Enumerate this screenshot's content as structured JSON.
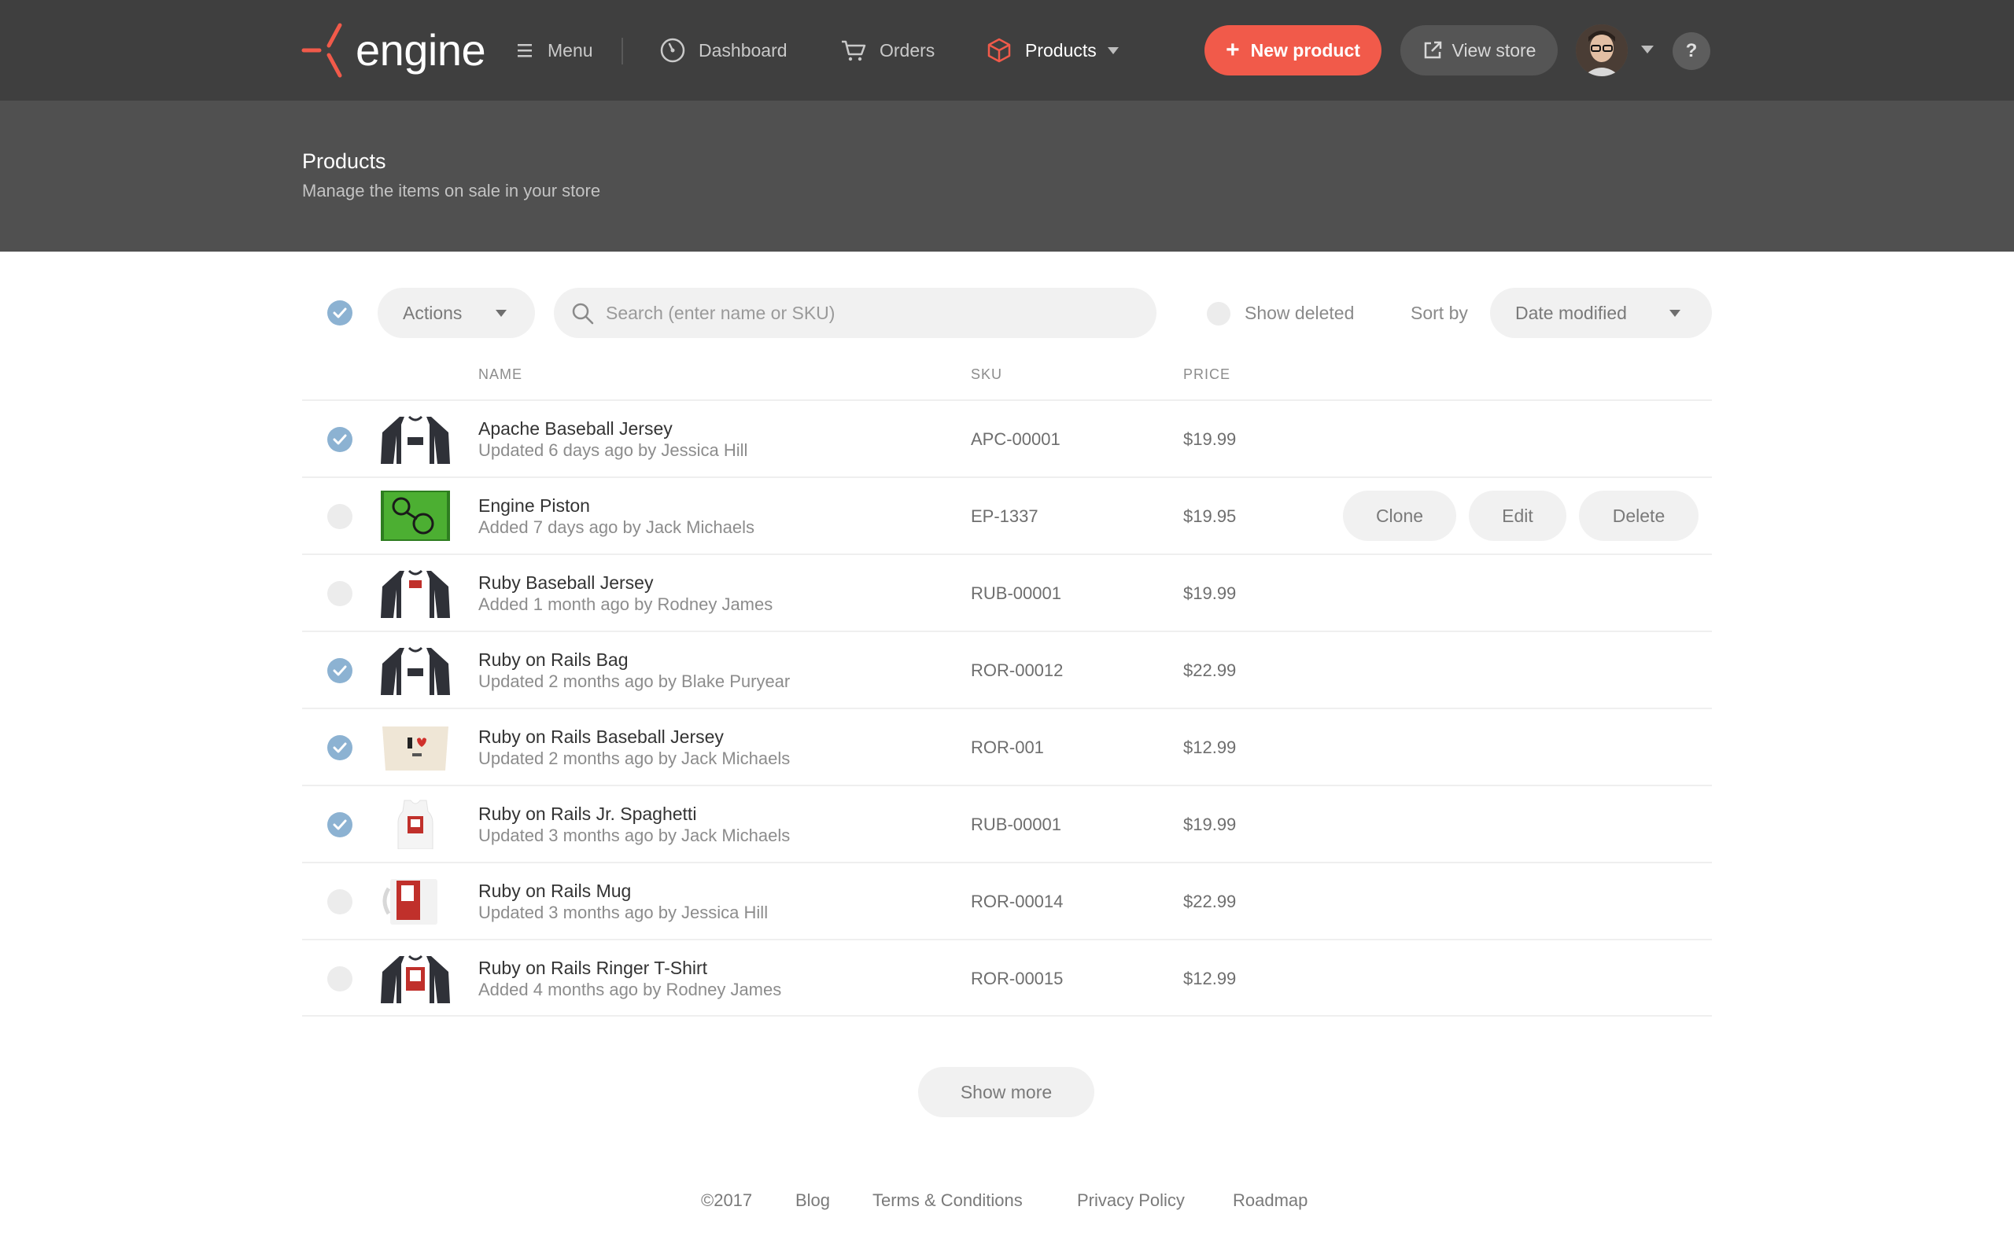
{
  "brand": {
    "name": "engine",
    "accent": "#f15a4a"
  },
  "nav": {
    "menu": "Menu",
    "dashboard": "Dashboard",
    "orders": "Orders",
    "products": "Products"
  },
  "header_actions": {
    "new_product": "New product",
    "view_store": "View store",
    "help": "?"
  },
  "page": {
    "title": "Products",
    "subtitle": "Manage the items on sale in your store"
  },
  "toolbar": {
    "select_all_checked": true,
    "actions_label": "Actions",
    "search_placeholder": "Search (enter name or SKU)",
    "search_value": "",
    "show_deleted_label": "Show deleted",
    "sort_by_label": "Sort by",
    "sort_value": "Date modified"
  },
  "table": {
    "columns": [
      "NAME",
      "SKU",
      "PRICE"
    ],
    "rows": [
      {
        "name": "Apache Baseball Jersey",
        "meta": "Updated 6 days ago by Jessica Hill",
        "sku": "APC-00001",
        "price": "$19.99",
        "checked": true,
        "thumb": "raglan-shirt-icon"
      },
      {
        "name": "Engine Piston",
        "meta": "Added 7 days ago by Jack Michaels",
        "sku": "EP-1337",
        "price": "$19.95",
        "checked": false,
        "thumb": "piston-icon"
      },
      {
        "name": "Ruby Baseball Jersey",
        "meta": "Added 1 month ago by Rodney James",
        "sku": "RUB-00001",
        "price": "$19.99",
        "checked": false,
        "thumb": "raglan-shirt-icon"
      },
      {
        "name": "Ruby on Rails Bag",
        "meta": "Updated 2 months ago by Blake Puryear",
        "sku": "ROR-00012",
        "price": "$22.99",
        "checked": true,
        "thumb": "raglan-shirt-icon"
      },
      {
        "name": "Ruby on Rails Baseball Jersey",
        "meta": "Updated 2 months ago by Jack Michaels",
        "sku": "ROR-001",
        "price": "$12.99",
        "checked": true,
        "thumb": "tote-bag-icon"
      },
      {
        "name": "Ruby on Rails Jr. Spaghetti",
        "meta": "Updated 3 months ago by Jack Michaels",
        "sku": "RUB-00001",
        "price": "$19.99",
        "checked": true,
        "thumb": "tank-top-icon"
      },
      {
        "name": "Ruby on Rails Mug",
        "meta": "Updated 3 months ago by Jessica Hill",
        "sku": "ROR-00014",
        "price": "$22.99",
        "checked": false,
        "thumb": "mug-icon"
      },
      {
        "name": "Ruby on Rails Ringer T-Shirt",
        "meta": "Added 4 months ago by Rodney James",
        "sku": "ROR-00015",
        "price": "$12.99",
        "checked": false,
        "thumb": "raglan-shirt-icon"
      }
    ],
    "row_actions": {
      "clone": "Clone",
      "edit": "Edit",
      "delete": "Delete"
    }
  },
  "show_more": "Show more",
  "footer": {
    "copyright": "©2017",
    "blog": "Blog",
    "terms": "Terms & Conditions",
    "privacy": "Privacy Policy",
    "roadmap": "Roadmap"
  }
}
